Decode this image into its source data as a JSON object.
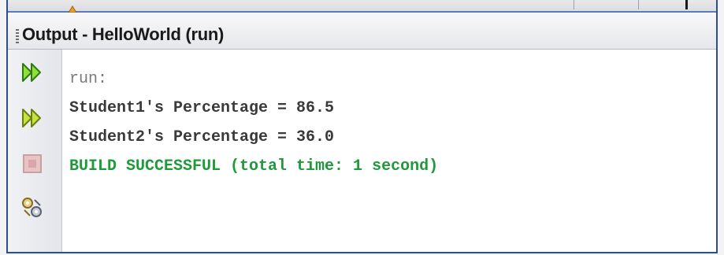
{
  "window": {
    "title": "Output - HelloWorld (run)"
  },
  "toolbar": {
    "icons": [
      "rerun-icon",
      "rerun-with-options-icon",
      "stop-icon",
      "settings-icon"
    ]
  },
  "console": {
    "lines": [
      {
        "text": "run:",
        "kind": "meta"
      },
      {
        "text": "Student1's Percentage = 86.5",
        "kind": "stdout"
      },
      {
        "text": "Student2's Percentage = 36.0",
        "kind": "stdout"
      },
      {
        "text": "BUILD SUCCESSFUL (total time: 1 second)",
        "kind": "success"
      }
    ]
  },
  "colors": {
    "frame": "#2b4f8a",
    "success": "#1f9a3a",
    "meta": "#7a7a7a",
    "stdout": "#3a3a3a"
  }
}
